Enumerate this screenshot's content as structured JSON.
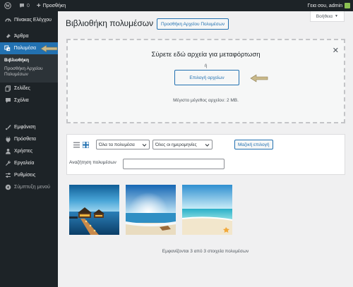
{
  "adminbar": {
    "comments_count": "0",
    "new_label": "Προσθήκη",
    "greeting": "Γεια σου, admin"
  },
  "sidebar": {
    "items": [
      {
        "label": "Πίνακας Ελέγχου",
        "icon": "dashboard-icon"
      },
      {
        "label": "Άρθρα",
        "icon": "pin-icon"
      },
      {
        "label": "Πολυμέσα",
        "icon": "media-icon"
      },
      {
        "label": "Σελίδες",
        "icon": "pages-icon"
      },
      {
        "label": "Σχόλια",
        "icon": "comments-icon"
      },
      {
        "label": "Εμφάνιση",
        "icon": "appearance-icon"
      },
      {
        "label": "Πρόσθετα",
        "icon": "plugins-icon"
      },
      {
        "label": "Χρήστες",
        "icon": "users-icon"
      },
      {
        "label": "Εργαλεία",
        "icon": "tools-icon"
      },
      {
        "label": "Ρυθμίσεις",
        "icon": "settings-icon"
      },
      {
        "label": "Σύμπτυξη μενού",
        "icon": "collapse-icon"
      }
    ],
    "submenu": {
      "library": "Βιβλιοθήκη",
      "add_new": "Προσθήκη Αρχείου Πολυμέσων"
    }
  },
  "help_label": "Βοήθεια",
  "page_title": "Βιβλιοθήκη πολυμέσων",
  "add_new_button": "Προσθήκη Αρχείου Πολυμέσων",
  "uploader": {
    "drop_text": "Σύρετε εδώ αρχεία για μεταφόρτωση",
    "or_text": "ή",
    "select_button": "Επιλογή αρχείων",
    "max_size": "Μέγιστο μέγεθος αρχείου: 2 MB."
  },
  "toolbar": {
    "type_filter": "Όλα τα πολυμέσα",
    "date_filter": "Όλες οι ημερομηνίες",
    "bulk_select": "Μαζική επιλογή",
    "search_label": "Αναζήτηση πολυμέσων",
    "search_value": ""
  },
  "count_text": "Εμφανίζονται 3 από 3 στοιχεία πολυμέσων",
  "colors": {
    "accent": "#2271b1",
    "adminbar": "#1d2327",
    "arrow": "#c9b98a"
  }
}
